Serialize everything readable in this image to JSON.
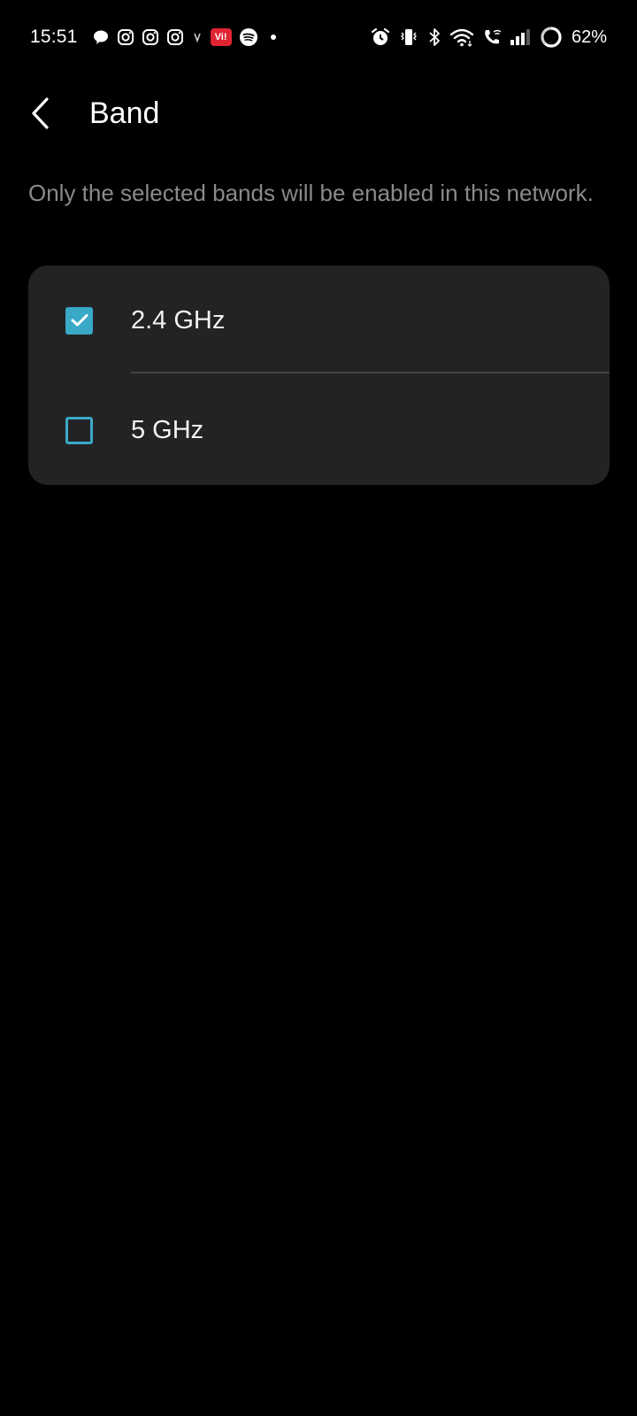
{
  "status_bar": {
    "time": "15:51",
    "left_icons": [
      "chat-bubble-icon",
      "instagram-icon",
      "instagram-icon",
      "instagram-icon",
      "small-app-icon",
      "vi-app-icon",
      "spotify-icon",
      "notification-dot-icon"
    ],
    "vi_label": "Vi!",
    "right_icons": [
      "alarm-icon",
      "vibrate-icon",
      "bluetooth-icon",
      "wifi-icon",
      "wifi-calling-icon",
      "signal-icon",
      "battery-ring-icon"
    ],
    "battery": "62%"
  },
  "header": {
    "title": "Band",
    "back_icon": "chevron-left-icon"
  },
  "description": "Only the selected bands will be enabled in this network.",
  "bands": [
    {
      "label": "2.4 GHz",
      "checked": true
    },
    {
      "label": "5 GHz",
      "checked": false
    }
  ],
  "colors": {
    "background": "#000000",
    "card": "#232325",
    "accent": "#3aa9c7",
    "description_text": "#8a8a8a",
    "divider": "#444446"
  }
}
